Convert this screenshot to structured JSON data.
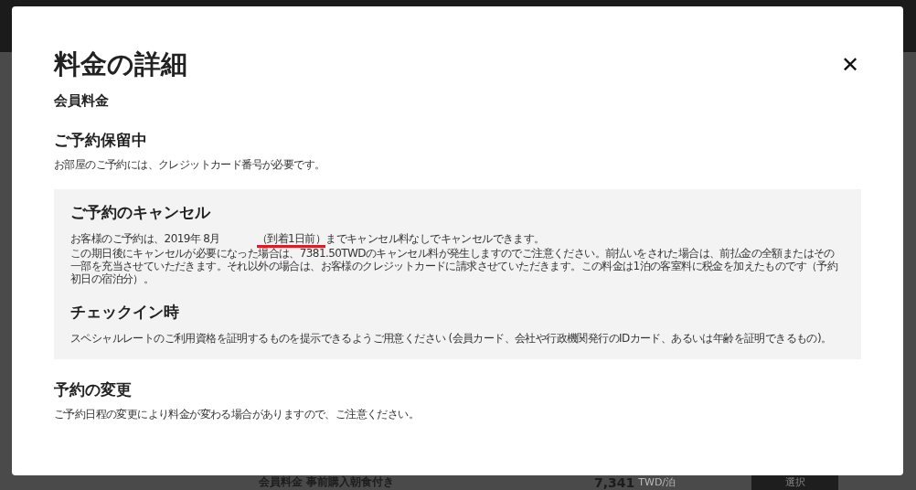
{
  "dialog": {
    "title": "料金の詳細",
    "subtitle": "会員料金",
    "close_icon": "✕",
    "hold": {
      "heading": "ご予約保留中",
      "text": "お部屋のご予約には、クレジットカード番号が必要です。"
    },
    "cancel": {
      "heading": "ご予約のキャンセル",
      "deadline_before": "お客様のご予約は、2019年 8月",
      "deadline_marked": "（到着1日前）",
      "deadline_after": "までキャンセル料なしでキャンセルできます。",
      "policy": "この期日後にキャンセルが必要になった場合は、7381.50TWDのキャンセル料が発生しますのでご注意ください。前払いをされた場合は、前払金の全額またはその一部を充当させていただきます。それ以外の場合は、お客様のクレジットカードに請求させていただきます。この料金は1泊の客室料に税金を加えたものです（予約初日の宿泊分）。"
    },
    "checkin": {
      "heading": "チェックイン時",
      "text": "スペシャルレートのご利用資格を証明するものを提示できるようご用意ください (会員カード、会社や行政機関発行のIDカード、あるいは年齢を証明できるもの)。"
    },
    "change": {
      "heading": "予約の変更",
      "text": "ご予約日程の変更により料金が変わる場合がありますので、ご注意ください。"
    }
  },
  "background": {
    "rate_name": "会員料金 事前購入朝食付き",
    "price": "7,341",
    "unit": "TWD/泊",
    "select_button": "選択"
  }
}
